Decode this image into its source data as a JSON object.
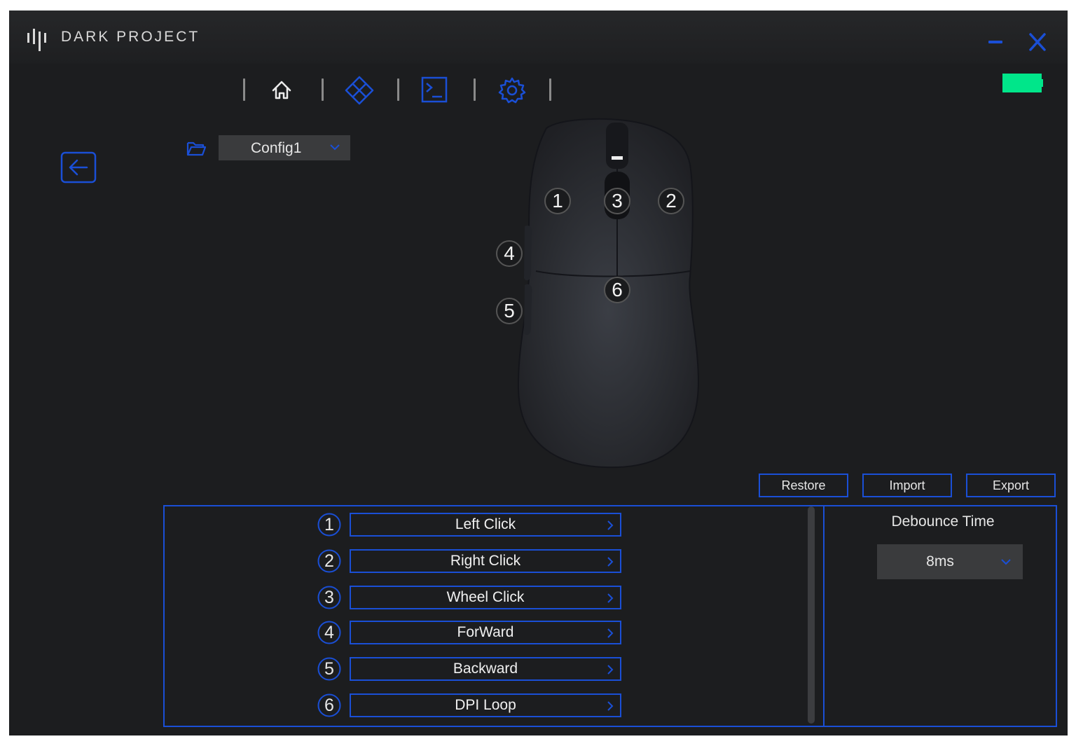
{
  "app": {
    "brand": "DARK PROJECT",
    "accent": "#1a4fd6",
    "battery_color": "#00e68a",
    "battery_level": 1.0
  },
  "nav": {
    "icons": [
      "home-icon",
      "diamond-icon",
      "terminal-icon",
      "gear-icon"
    ],
    "active": "terminal-icon"
  },
  "config": {
    "selected": "Config1"
  },
  "mouse_badges": [
    "1",
    "2",
    "3",
    "4",
    "5",
    "6"
  ],
  "toolbar": {
    "restore": "Restore",
    "import": "Import",
    "export": "Export"
  },
  "bindings": [
    {
      "num": "1",
      "label": "Left Click"
    },
    {
      "num": "2",
      "label": "Right Click"
    },
    {
      "num": "3",
      "label": "Wheel Click"
    },
    {
      "num": "4",
      "label": "ForWard"
    },
    {
      "num": "5",
      "label": "Backward"
    },
    {
      "num": "6",
      "label": "DPI Loop"
    }
  ],
  "debounce": {
    "label": "Debounce Time",
    "value": "8ms"
  }
}
